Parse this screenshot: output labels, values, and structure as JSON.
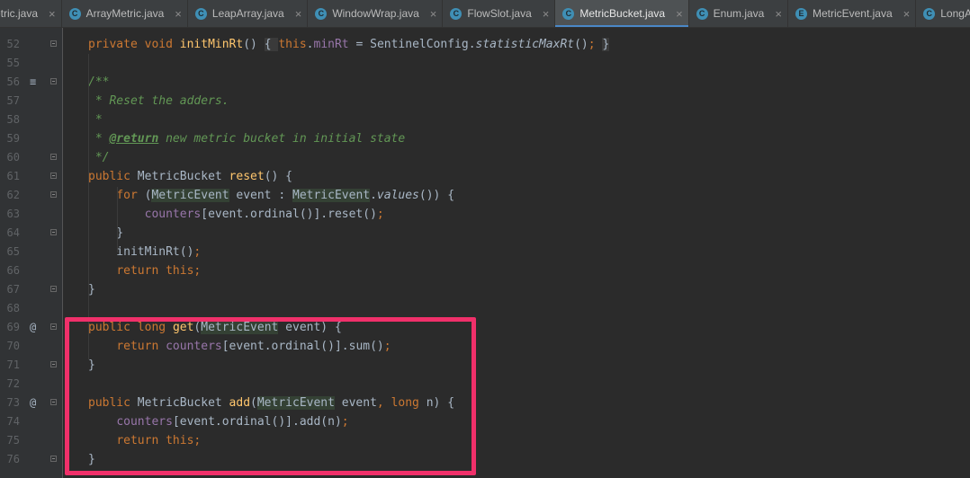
{
  "tabs": [
    {
      "label": "Metric.java",
      "icon": "I",
      "active": false
    },
    {
      "label": "ArrayMetric.java",
      "icon": "C",
      "active": false
    },
    {
      "label": "LeapArray.java",
      "icon": "C",
      "active": false
    },
    {
      "label": "WindowWrap.java",
      "icon": "C",
      "active": false
    },
    {
      "label": "FlowSlot.java",
      "icon": "C",
      "active": false
    },
    {
      "label": "MetricBucket.java",
      "icon": "C",
      "active": true
    },
    {
      "label": "Enum.java",
      "icon": "C",
      "active": false
    },
    {
      "label": "MetricEvent.java",
      "icon": "E",
      "active": false
    },
    {
      "label": "LongAdder.java",
      "icon": "C",
      "active": false
    }
  ],
  "colors": {
    "editor_bg": "#2b2b2b",
    "keyword": "#cc7832",
    "method": "#ffc66d",
    "field": "#9876aa",
    "doc_comment": "#629755",
    "highlight_box": "#f0306a",
    "active_tab_underline": "#4a88c7"
  },
  "code": {
    "lines": [
      {
        "num": "52",
        "gutter_mark": "",
        "fold": true,
        "tokens": [
          {
            "t": "private ",
            "c": "kw"
          },
          {
            "t": "void ",
            "c": "kw"
          },
          {
            "t": "initMinRt",
            "c": "fn"
          },
          {
            "t": "() "
          },
          {
            "t": "{ ",
            "c": "fold-box"
          },
          {
            "t": "this",
            "c": "kw"
          },
          {
            "t": "."
          },
          {
            "t": "minRt",
            "c": "field"
          },
          {
            "t": " = SentinelConfig."
          },
          {
            "t": "statisticMaxRt",
            "c": "ital"
          },
          {
            "t": "()",
            "c": ""
          },
          {
            "t": "; ",
            "c": "kw"
          },
          {
            "t": "}",
            "c": "fold-box"
          }
        ]
      },
      {
        "num": "55",
        "gutter_mark": "",
        "fold": false,
        "tokens": []
      },
      {
        "num": "56",
        "gutter_mark": "≡",
        "fold": true,
        "tokens": [
          {
            "t": "/**",
            "c": "doc"
          }
        ]
      },
      {
        "num": "57",
        "gutter_mark": "",
        "fold": false,
        "tokens": [
          {
            "t": " * Reset the adders.",
            "c": "doc"
          }
        ]
      },
      {
        "num": "58",
        "gutter_mark": "",
        "fold": false,
        "tokens": [
          {
            "t": " *",
            "c": "doc"
          }
        ]
      },
      {
        "num": "59",
        "gutter_mark": "",
        "fold": false,
        "tokens": [
          {
            "t": " * ",
            "c": "doc"
          },
          {
            "t": "@return",
            "c": "doctag"
          },
          {
            "t": " new metric bucket in initial state",
            "c": "doc"
          }
        ]
      },
      {
        "num": "60",
        "gutter_mark": "",
        "fold": true,
        "tokens": [
          {
            "t": " */",
            "c": "doc"
          }
        ]
      },
      {
        "num": "61",
        "gutter_mark": "",
        "fold": true,
        "tokens": [
          {
            "t": "public ",
            "c": "kw"
          },
          {
            "t": "MetricBucket "
          },
          {
            "t": "reset",
            "c": "fn"
          },
          {
            "t": "() {"
          }
        ]
      },
      {
        "num": "62",
        "gutter_mark": "",
        "fold": true,
        "tokens": [
          {
            "t": "    "
          },
          {
            "t": "for ",
            "c": "kw"
          },
          {
            "t": "("
          },
          {
            "t": "MetricEvent",
            "c": "typehl"
          },
          {
            "t": " event : "
          },
          {
            "t": "MetricEvent",
            "c": "typehl"
          },
          {
            "t": "."
          },
          {
            "t": "values",
            "c": "ital"
          },
          {
            "t": "()) {"
          }
        ]
      },
      {
        "num": "63",
        "gutter_mark": "",
        "fold": false,
        "tokens": [
          {
            "t": "        "
          },
          {
            "t": "counters",
            "c": "field"
          },
          {
            "t": "[event.ordinal()].reset()"
          },
          {
            "t": ";",
            "c": "kw"
          }
        ]
      },
      {
        "num": "64",
        "gutter_mark": "",
        "fold": true,
        "tokens": [
          {
            "t": "    }"
          }
        ]
      },
      {
        "num": "65",
        "gutter_mark": "",
        "fold": false,
        "tokens": [
          {
            "t": "    initMinRt()"
          },
          {
            "t": ";",
            "c": "kw"
          }
        ]
      },
      {
        "num": "66",
        "gutter_mark": "",
        "fold": false,
        "tokens": [
          {
            "t": "    "
          },
          {
            "t": "return this;",
            "c": "kw"
          }
        ]
      },
      {
        "num": "67",
        "gutter_mark": "",
        "fold": true,
        "tokens": [
          {
            "t": "}"
          }
        ]
      },
      {
        "num": "68",
        "gutter_mark": "",
        "fold": false,
        "tokens": []
      },
      {
        "num": "69",
        "gutter_mark": "@",
        "fold": true,
        "tokens": [
          {
            "t": "public ",
            "c": "kw"
          },
          {
            "t": "long ",
            "c": "kw"
          },
          {
            "t": "get",
            "c": "fn"
          },
          {
            "t": "("
          },
          {
            "t": "MetricEvent",
            "c": "typehl"
          },
          {
            "t": " event) {"
          }
        ]
      },
      {
        "num": "70",
        "gutter_mark": "",
        "fold": false,
        "tokens": [
          {
            "t": "    "
          },
          {
            "t": "return ",
            "c": "kw"
          },
          {
            "t": "counters",
            "c": "field"
          },
          {
            "t": "[event.ordinal()].sum()"
          },
          {
            "t": ";",
            "c": "kw"
          }
        ]
      },
      {
        "num": "71",
        "gutter_mark": "",
        "fold": true,
        "tokens": [
          {
            "t": "}"
          }
        ]
      },
      {
        "num": "72",
        "gutter_mark": "",
        "fold": false,
        "tokens": []
      },
      {
        "num": "73",
        "gutter_mark": "@",
        "fold": true,
        "tokens": [
          {
            "t": "public ",
            "c": "kw"
          },
          {
            "t": "MetricBucket "
          },
          {
            "t": "add",
            "c": "fn"
          },
          {
            "t": "("
          },
          {
            "t": "MetricEvent",
            "c": "typehl"
          },
          {
            "t": " event"
          },
          {
            "t": ", ",
            "c": "kw"
          },
          {
            "t": "long ",
            "c": "kw"
          },
          {
            "t": "n) {"
          }
        ]
      },
      {
        "num": "74",
        "gutter_mark": "",
        "fold": false,
        "tokens": [
          {
            "t": "    "
          },
          {
            "t": "counters",
            "c": "field"
          },
          {
            "t": "[event.ordinal()].add(n)"
          },
          {
            "t": ";",
            "c": "kw"
          }
        ]
      },
      {
        "num": "75",
        "gutter_mark": "",
        "fold": false,
        "tokens": [
          {
            "t": "    "
          },
          {
            "t": "return this;",
            "c": "kw"
          }
        ]
      },
      {
        "num": "76",
        "gutter_mark": "",
        "fold": true,
        "tokens": [
          {
            "t": "}"
          }
        ]
      }
    ]
  }
}
